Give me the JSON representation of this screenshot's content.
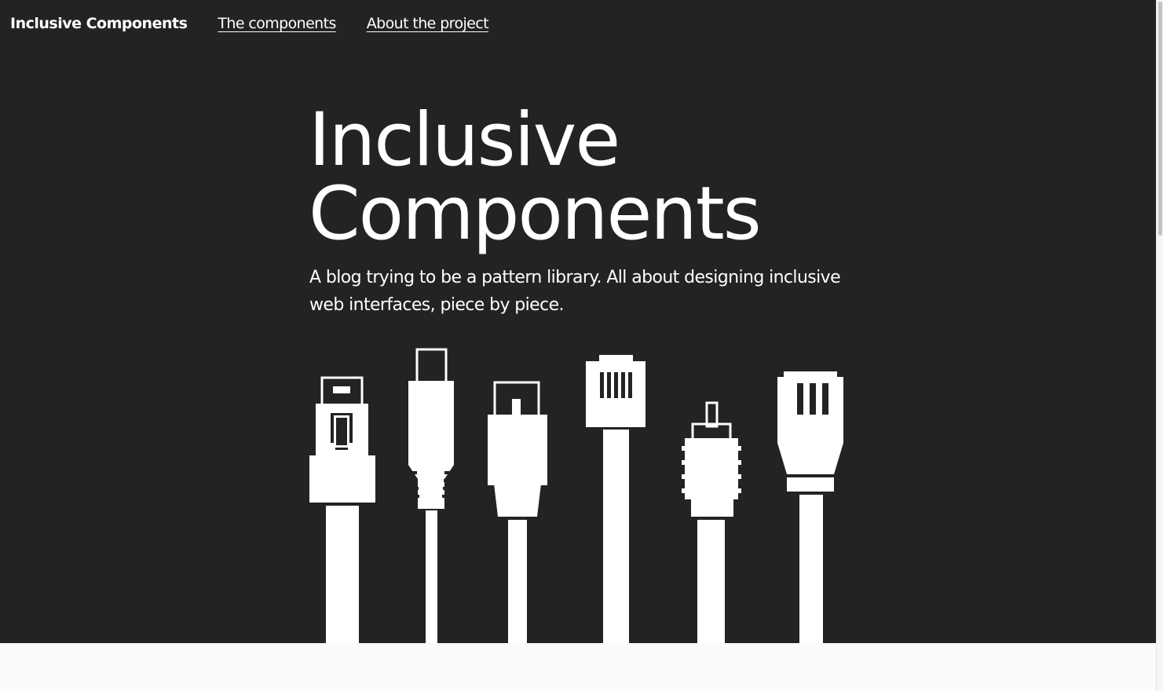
{
  "nav": {
    "brand": "Inclusive Components",
    "links": [
      "The components",
      "About the project"
    ]
  },
  "hero": {
    "title_line1": "Inclusive",
    "title_line2": "Components",
    "subtitle": "A blog trying to be a pattern library. All about designing inclusive web interfaces, piece by piece."
  },
  "illustration": {
    "connectors": [
      "usb-a-plug-icon",
      "usb-mini-plug-icon",
      "usb-b-plug-icon",
      "phone-jack-plug-icon",
      "rca-plug-icon",
      "ethernet-plug-icon"
    ]
  },
  "colors": {
    "hero_background": "#232323",
    "text": "#ffffff",
    "page_background": "#fafafa"
  }
}
